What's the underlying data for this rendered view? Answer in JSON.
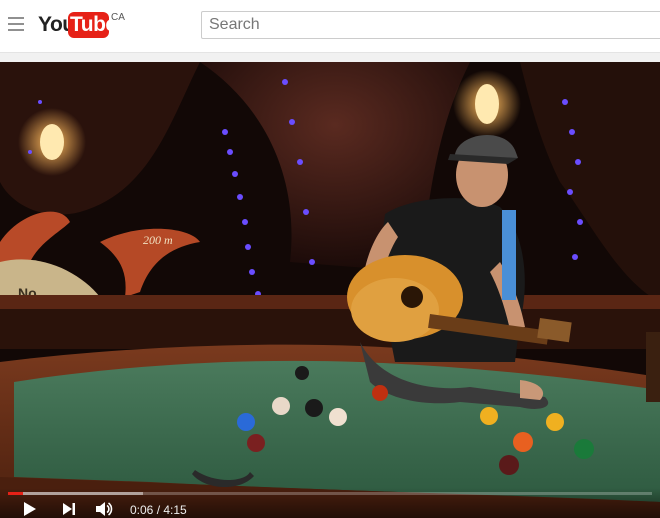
{
  "masthead": {
    "logo_you": "You",
    "logo_tube": "Tube",
    "region": "CA",
    "search_placeholder": "Search"
  },
  "player": {
    "current_time": "0:06",
    "duration": "4:15",
    "time_display": "0:06 / 4:15",
    "progress_fraction": 0.024,
    "buffer_fraction": 0.21,
    "scene_sign_text": "200 m",
    "scene_sign_fragment": "No"
  },
  "colors": {
    "brand_red": "#e62117",
    "felt_green": "#3f6a4f",
    "string_lights": "#6a4dff"
  },
  "icons": [
    "menu-icon",
    "play-icon",
    "next-icon",
    "volume-icon"
  ]
}
